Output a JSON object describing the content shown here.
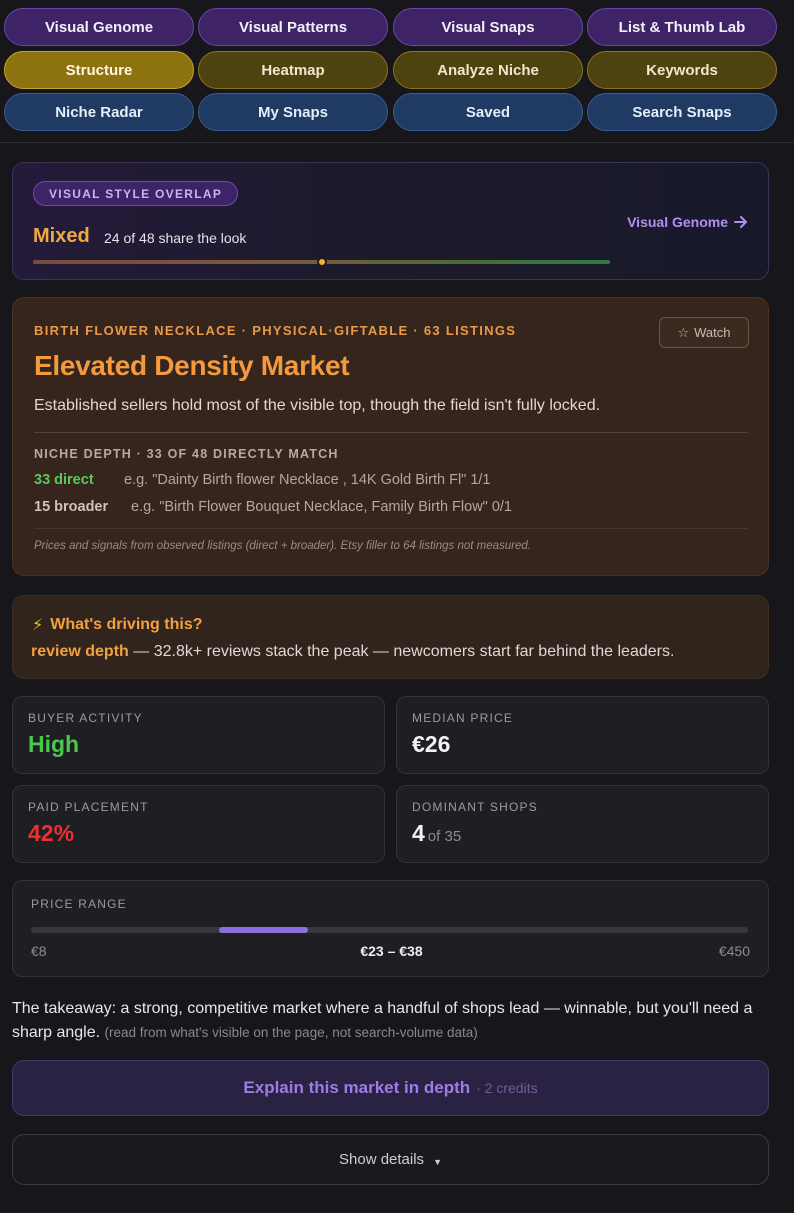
{
  "nav": {
    "row1": [
      "Visual Genome",
      "Visual Patterns",
      "Visual Snaps",
      "List & Thumb Lab"
    ],
    "row2": [
      "Structure",
      "Heatmap",
      "Analyze Niche",
      "Keywords"
    ],
    "row3": [
      "Niche Radar",
      "My Snaps",
      "Saved",
      "Search Snaps"
    ],
    "active": "Structure"
  },
  "overlap": {
    "tag": "VISUAL STYLE OVERLAP",
    "level": "Mixed",
    "share_text": "24 of 48 share the look",
    "shared": 24,
    "total": 48,
    "link_label": "Visual Genome",
    "link_icon": "arrow-right-icon"
  },
  "market": {
    "eyebrow": "BIRTH FLOWER NECKLACE · PHYSICAL·GIFTABLE · 63 LISTINGS",
    "watch_icon": "star-outline-icon",
    "watch_label": "Watch",
    "headline": "Elevated Density Market",
    "description": "Established sellers hold most of the visible top, though the field isn't fully locked.",
    "depth_title": "NICHE DEPTH · 33 OF 48 DIRECTLY MATCH",
    "direct_count": "33 direct",
    "direct_example": "e.g. \"Dainty Birth flower Necklace , 14K Gold Birth Fl\" 1/1",
    "broader_count": "15 broader",
    "broader_example": "e.g. \"Birth Flower Bouquet Necklace, Family Birth Flow\" 0/1",
    "note": "Prices and signals from observed listings (direct + broader). Etsy filler to 64 listings not measured."
  },
  "driver": {
    "icon": "lightning-icon",
    "question": "What's driving this?",
    "driver_term": "review depth",
    "driver_text": " — 32.8k+ reviews stack the peak — newcomers start far behind the leaders."
  },
  "stats": {
    "buyer_activity": {
      "label": "BUYER ACTIVITY",
      "value": "High"
    },
    "median_price": {
      "label": "MEDIAN PRICE",
      "value": "€26"
    },
    "paid_placement": {
      "label": "PAID PLACEMENT",
      "value": "42%"
    },
    "dominant_shops": {
      "label": "DOMINANT SHOPS",
      "value": "4",
      "sub": "of 35"
    }
  },
  "price_range": {
    "label": "PRICE RANGE",
    "min_label": "€8",
    "range_label": "€23 – €38",
    "max_label": "€450",
    "min": 8,
    "max": 450,
    "low": 23,
    "high": 38
  },
  "takeaway": {
    "text": "The takeaway: a strong, competitive market where a handful of shops lead — winnable, but you'll need a sharp angle.",
    "fine": "(read from what's visible on the page, not search-volume data)"
  },
  "actions": {
    "explain_label": "Explain this market in depth",
    "explain_credits": "· 2 credits",
    "details_label": "Show details",
    "details_icon": "caret-down-icon"
  },
  "colors": {
    "accent_orange": "#f39a3e",
    "accent_purple": "#9d7ce6",
    "positive_green": "#49c84e",
    "negative_red": "#ee2f33"
  }
}
